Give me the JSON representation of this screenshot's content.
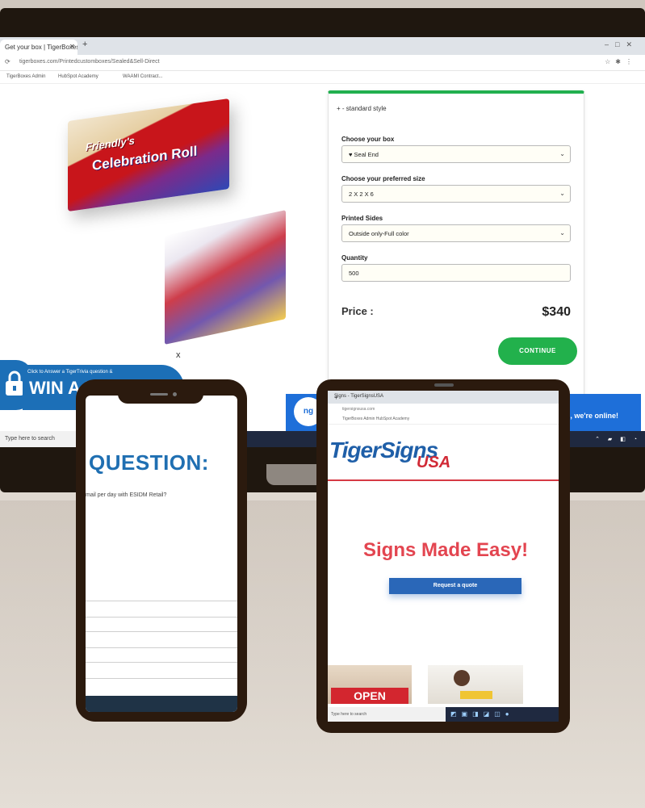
{
  "browser": {
    "tab_title": "Get your box | TigerBoxes",
    "url": "tigerboxes.com/Printedcustomboxes/Sealed&Sell-Direct",
    "bookmarks": [
      "TigerBoxes Admin",
      "HubSpot Academy",
      "WAAMI Contract..."
    ]
  },
  "product": {
    "box_title_1": "Friendly's",
    "box_title_2": "Celebration Roll"
  },
  "form": {
    "style_label": "+ - standard style",
    "box_label": "Choose your box",
    "box_value": "♥ Seal End",
    "size_label": "Choose your preferred size",
    "size_value": "2 X 2 X 6",
    "sides_label": "Printed Sides",
    "sides_value": "Outside only-Full color",
    "qty_label": "Quantity",
    "qty_value": "500",
    "price_label": "Price :",
    "price_value": "$340",
    "continue_label": "CONTINUE"
  },
  "popup": {
    "close": "x",
    "banner_small": "Click to Answer a TigerTrivia question &",
    "banner_big": "WIN A PRIZE"
  },
  "chat": {
    "bubble": "ng",
    "message": "u, we're online!"
  },
  "taskbar": {
    "search": "Type here to search"
  },
  "phone": {
    "heading": "QUESTION:",
    "subtext": "mail per day with ESIDM Retail?"
  },
  "tablet": {
    "tab_title": "Signs - TigerSignsUSA",
    "url": "tigersignsusa.com",
    "bookmarks": "TigerBoxes Admin   HubSpot Academy",
    "logo_main": "TigerSigns",
    "logo_sub": "USA",
    "headline": "Signs Made Easy!",
    "quote_button": "Request a quote",
    "open_sign": "OPEN",
    "taskbar_search": "Type here to search"
  },
  "colors": {
    "accent_green": "#22b14c",
    "brand_blue": "#1c6fb7",
    "headline_red": "#e34550",
    "frame_brown": "#2b1a0e"
  }
}
